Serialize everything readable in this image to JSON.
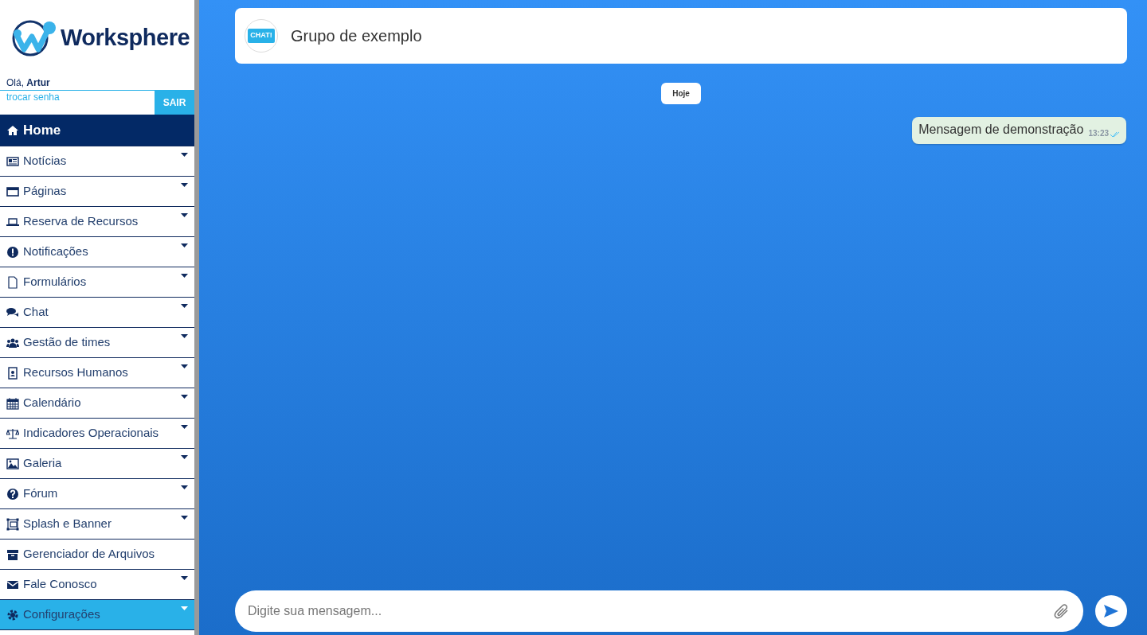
{
  "brand": {
    "name": "Worksphere"
  },
  "user": {
    "greeting": "Olá,",
    "name": "Artur",
    "change_password": "trocar senha",
    "logout": "SAIR"
  },
  "sidebar": {
    "items": [
      {
        "label": "Home",
        "kind": "home",
        "has_submenu": false,
        "selected": false
      },
      {
        "label": "Notícias",
        "kind": "menu",
        "has_submenu": true,
        "selected": false
      },
      {
        "label": "Páginas",
        "kind": "menu",
        "has_submenu": true,
        "selected": false
      },
      {
        "label": "Reserva de Recursos",
        "kind": "menu",
        "has_submenu": true,
        "selected": false
      },
      {
        "label": "Notificações",
        "kind": "menu",
        "has_submenu": true,
        "selected": false
      },
      {
        "label": "Formulários",
        "kind": "menu",
        "has_submenu": true,
        "selected": false
      },
      {
        "label": "Chat",
        "kind": "menu",
        "has_submenu": true,
        "selected": false
      },
      {
        "label": "Gestão de times",
        "kind": "menu",
        "has_submenu": true,
        "selected": false
      },
      {
        "label": "Recursos Humanos",
        "kind": "menu",
        "has_submenu": true,
        "selected": false
      },
      {
        "label": "Calendário",
        "kind": "menu",
        "has_submenu": true,
        "selected": false
      },
      {
        "label": "Indicadores Operacionais",
        "kind": "menu",
        "has_submenu": true,
        "selected": false
      },
      {
        "label": "Galeria",
        "kind": "menu",
        "has_submenu": true,
        "selected": false
      },
      {
        "label": "Fórum",
        "kind": "menu",
        "has_submenu": true,
        "selected": false
      },
      {
        "label": "Splash e Banner",
        "kind": "menu",
        "has_submenu": true,
        "selected": false
      },
      {
        "label": "Gerenciador de Arquivos",
        "kind": "menu",
        "has_submenu": false,
        "selected": false
      },
      {
        "label": "Fale Conosco",
        "kind": "menu",
        "has_submenu": true,
        "selected": false
      },
      {
        "label": "Configurações",
        "kind": "menu",
        "has_submenu": true,
        "selected": true
      }
    ]
  },
  "chat": {
    "title": "Grupo de exemplo",
    "avatar_text": "CHAT!",
    "date_separator": "Hoje",
    "messages": [
      {
        "text": "Mensagem de demonstração",
        "time": "13:23",
        "read": true
      }
    ],
    "composer": {
      "placeholder": "Digite sua mensagem..."
    }
  }
}
